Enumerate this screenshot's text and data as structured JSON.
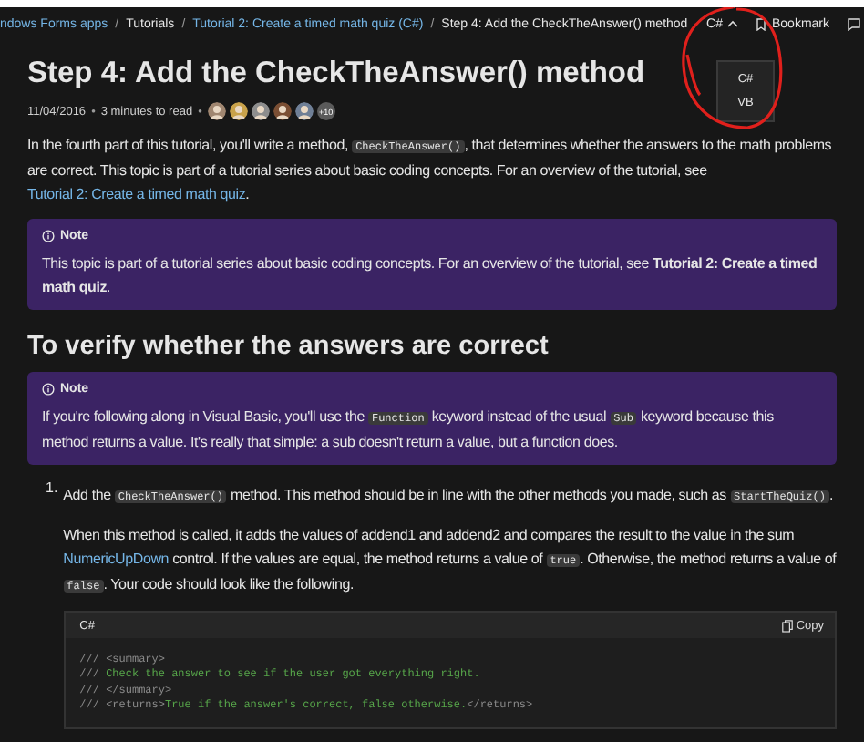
{
  "breadcrumbs": {
    "separator": "/",
    "items": [
      {
        "label": "ndows Forms apps",
        "kind": "link"
      },
      {
        "label": "Tutorials",
        "kind": "text"
      },
      {
        "label": "Tutorial 2: Create a timed math quiz (C#)",
        "kind": "link"
      },
      {
        "label": "Step 4: Add the CheckTheAnswer() method",
        "kind": "text"
      }
    ]
  },
  "language_menu": {
    "label": "C#",
    "expanded": true,
    "options": [
      "C#",
      "VB"
    ]
  },
  "bookmark": {
    "label": "Bookmark"
  },
  "annotation": {
    "kind": "circle",
    "color": "#e0201c"
  },
  "title": "Step 4: Add the CheckTheAnswer() method",
  "meta": {
    "dot": "•",
    "date": "11/04/2016",
    "read_time": "3 minutes to read",
    "avatars": [
      {
        "color": "#a08670"
      },
      {
        "color": "#c9a24a"
      },
      {
        "color": "#8d8d8d"
      },
      {
        "color": "#7a4e33"
      },
      {
        "color": "#6f7f96"
      }
    ],
    "more": "+10"
  },
  "intro": [
    {
      "kind": "text",
      "text": "In the fourth part of this tutorial, you'll write a method, "
    },
    {
      "kind": "code",
      "text": "CheckTheAnswer()"
    },
    {
      "kind": "text",
      "text": ", that determines whether the answers to the math problems are correct. This topic is part of a tutorial series about basic coding concepts. For an overview of the tutorial, see "
    },
    {
      "kind": "link",
      "text": "Tutorial 2: Create a timed math quiz"
    },
    {
      "kind": "text",
      "text": "."
    }
  ],
  "note_1": {
    "title": "Note",
    "body": [
      {
        "kind": "text",
        "text": "This topic is part of a tutorial series about basic coding concepts. For an overview of the tutorial, see "
      },
      {
        "kind": "bold",
        "text": "Tutorial 2: Create a timed math quiz"
      },
      {
        "kind": "text",
        "text": "."
      }
    ]
  },
  "heading": "To verify whether the answers are correct",
  "note_2": {
    "title": "Note",
    "body": [
      {
        "kind": "text",
        "text": "If you're following along in Visual Basic, you'll use the "
      },
      {
        "kind": "code",
        "text": "Function"
      },
      {
        "kind": "text",
        "text": " keyword instead of the usual "
      },
      {
        "kind": "code",
        "text": "Sub"
      },
      {
        "kind": "text",
        "text": " keyword because this method returns a value. It's really that simple: a sub doesn't return a value, but a function does."
      }
    ]
  },
  "steps": [
    {
      "number": "1.",
      "text": [
        {
          "kind": "text",
          "text": "Add the "
        },
        {
          "kind": "code",
          "text": "CheckTheAnswer()"
        },
        {
          "kind": "text",
          "text": " method. This method should be in line with the other methods you made, such as "
        },
        {
          "kind": "code",
          "text": "StartTheQuiz()"
        },
        {
          "kind": "text",
          "text": "."
        }
      ],
      "detail": [
        {
          "kind": "text",
          "text": "When this method is called, it adds the values of addend1 and addend2 and compares the result to the value in the sum "
        },
        {
          "kind": "link",
          "text": "NumericUpDown"
        },
        {
          "kind": "text",
          "text": " control. If the values are equal, the method returns a value of "
        },
        {
          "kind": "code",
          "text": "true"
        },
        {
          "kind": "text",
          "text": ". Otherwise, the method returns a value of "
        },
        {
          "kind": "code",
          "text": "false"
        },
        {
          "kind": "text",
          "text": ". Your code should look like the following."
        }
      ],
      "code": {
        "language": "C#",
        "copy": "Copy",
        "lines": [
          [
            {
              "kind": "comment",
              "text": "/// <summary>"
            }
          ],
          [
            {
              "kind": "comment",
              "text": "/// "
            },
            {
              "kind": "doc",
              "text": "Check the answer to see if the user got everything right."
            }
          ],
          [
            {
              "kind": "comment",
              "text": "/// </summary>"
            }
          ],
          [
            {
              "kind": "comment",
              "text": "/// <returns>"
            },
            {
              "kind": "doc",
              "text": "True if the answer's correct, false otherwise."
            },
            {
              "kind": "comment",
              "text": "</returns>"
            }
          ]
        ]
      }
    }
  ]
}
